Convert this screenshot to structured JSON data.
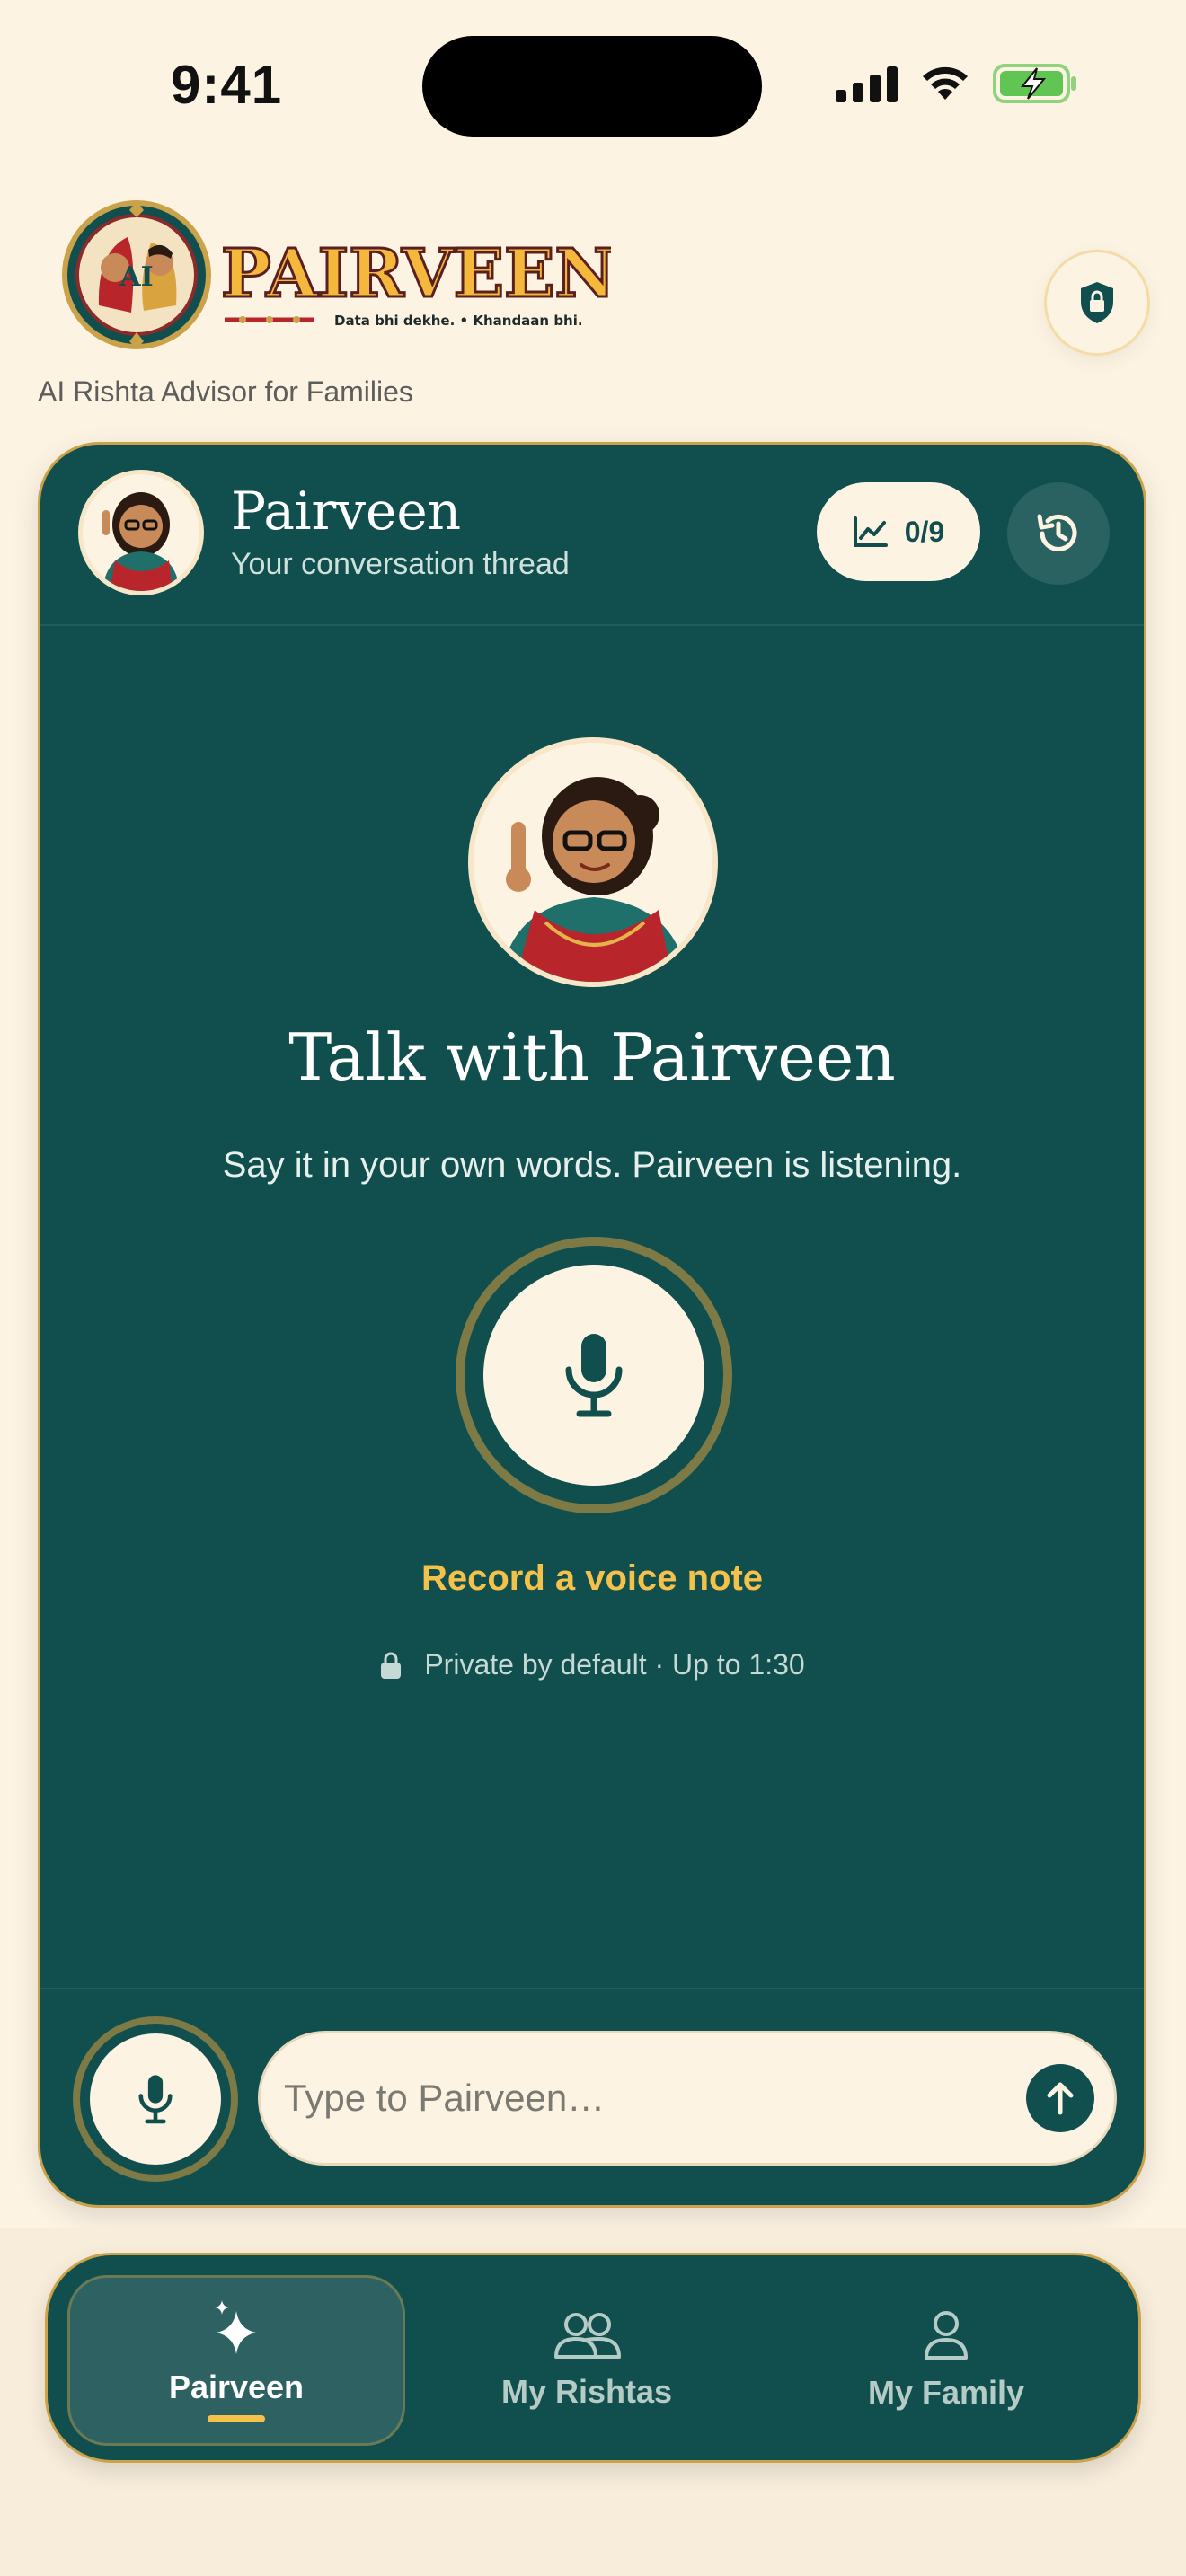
{
  "status_bar": {
    "time": "9:41",
    "icons": [
      "cellular-signal-icon",
      "wifi-icon",
      "battery-charging-icon"
    ]
  },
  "brand": {
    "logo_text": "PAIRVEEN",
    "logo_subtext": "Data bhi dekhe. • Khandaan bhi.",
    "tagline": "AI Rishta Advisor for Families"
  },
  "header": {
    "privacy_icon": "shield-lock-icon"
  },
  "chat_card": {
    "title": "Pairveen",
    "subtitle": "Your conversation thread",
    "progress_icon": "chart-line-icon",
    "progress_label": "0/9",
    "history_icon": "history-icon"
  },
  "hero": {
    "title": "Talk with Pairveen",
    "subtitle": "Say it in your own words. Pairveen is listening.",
    "record_label": "Record a voice note",
    "privacy_note": "Private by default · Up to 1:30"
  },
  "composer": {
    "placeholder": "Type to Pairveen…",
    "value": ""
  },
  "nav": {
    "items": [
      {
        "label": "Pairveen",
        "icon": "sparkle-icon",
        "active": true
      },
      {
        "label": "My Rishtas",
        "icon": "people-icon",
        "active": false
      },
      {
        "label": "My Family",
        "icon": "person-icon",
        "active": false
      }
    ]
  },
  "colors": {
    "background": "#fdf3e3",
    "card": "#114e4e",
    "accent_gold": "#f4c24a",
    "cream": "#fdf3e3"
  }
}
